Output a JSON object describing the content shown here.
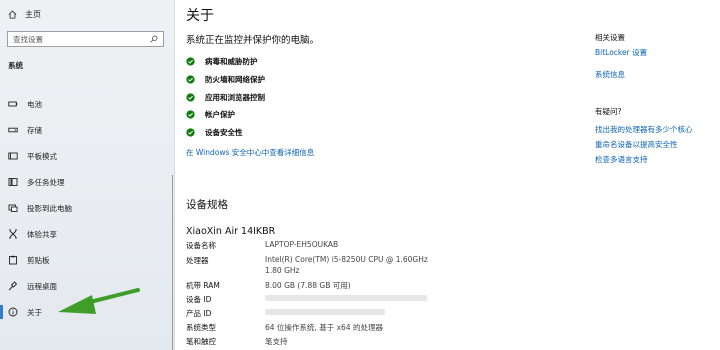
{
  "sidebar": {
    "home_label": "主页",
    "search_placeholder": "查找设置",
    "section_title": "系统",
    "items": [
      {
        "label": "电池",
        "icon": "battery-icon"
      },
      {
        "label": "存储",
        "icon": "storage-icon"
      },
      {
        "label": "平板模式",
        "icon": "tablet-mode-icon"
      },
      {
        "label": "多任务处理",
        "icon": "multitasking-icon"
      },
      {
        "label": "投影到此电脑",
        "icon": "projecting-icon"
      },
      {
        "label": "体验共享",
        "icon": "shared-experiences-icon"
      },
      {
        "label": "剪贴板",
        "icon": "clipboard-icon"
      },
      {
        "label": "远程桌面",
        "icon": "remote-desktop-icon"
      },
      {
        "label": "关于",
        "icon": "info-icon",
        "active": true
      }
    ]
  },
  "main": {
    "title": "关于",
    "status": "系统正在监控并保护你的电脑。",
    "protections": [
      "病毒和威胁防护",
      "防火墙和网络保护",
      "应用和浏览器控制",
      "帐户保护",
      "设备安全性"
    ],
    "details_link": "在 Windows 安全中心中查看详细信息",
    "spec_title": "设备规格",
    "device_name": "XiaoXin Air 14IKBR",
    "specs": [
      {
        "label": "设备名称",
        "value": "LAPTOP-EH5OUKAB"
      },
      {
        "label": "处理器",
        "value": "Intel(R) Core(TM) i5-8250U CPU @ 1.60GHz",
        "value2": "1.80 GHz"
      },
      {
        "label": "机带 RAM",
        "value": "8.00 GB (7.88 GB 可用)"
      },
      {
        "label": "设备 ID",
        "value": ""
      },
      {
        "label": "产品 ID",
        "value": ""
      },
      {
        "label": "系统类型",
        "value": "64 位操作系统, 基于 x64 的处理器"
      },
      {
        "label": "笔和触控",
        "value": "笔支持"
      }
    ]
  },
  "related": {
    "heading": "相关设置",
    "links": [
      "BitLocker 设置",
      "系统信息"
    ],
    "question_heading": "有疑问?",
    "question_links": [
      "找出我的处理器有多少个核心",
      "重命名设备以提高安全性",
      "检查多语言支持"
    ]
  },
  "colors": {
    "accent": "#0a63b8",
    "check_green": "#107c10",
    "annotation_arrow": "#3f9e2a"
  }
}
